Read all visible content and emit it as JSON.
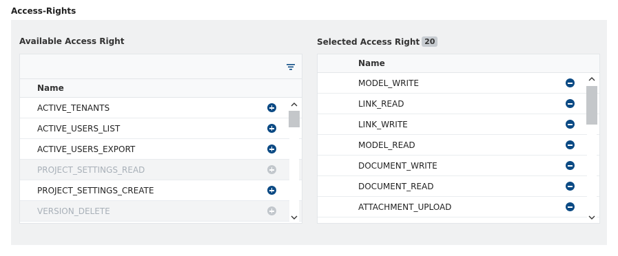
{
  "section": {
    "title": "Access-Rights"
  },
  "available": {
    "title": "Available Access Right",
    "column_header": "Name",
    "items": [
      {
        "label": "ACTIVE_TENANTS",
        "disabled": false
      },
      {
        "label": "ACTIVE_USERS_LIST",
        "disabled": false
      },
      {
        "label": "ACTIVE_USERS_EXPORT",
        "disabled": false
      },
      {
        "label": "PROJECT_SETTINGS_READ",
        "disabled": true
      },
      {
        "label": "PROJECT_SETTINGS_CREATE",
        "disabled": false
      },
      {
        "label": "VERSION_DELETE",
        "disabled": true
      }
    ]
  },
  "selected": {
    "title": "Selected Access Right",
    "count": "20",
    "column_header": "Name",
    "items": [
      {
        "label": "MODEL_WRITE"
      },
      {
        "label": "LINK_READ"
      },
      {
        "label": "LINK_WRITE"
      },
      {
        "label": "MODEL_READ"
      },
      {
        "label": "DOCUMENT_WRITE"
      },
      {
        "label": "DOCUMENT_READ"
      },
      {
        "label": "ATTACHMENT_UPLOAD"
      }
    ]
  },
  "colors": {
    "accent": "#0b4a84",
    "disabled": "#c2c7cc",
    "panel": "#f0f1f2"
  },
  "icons": {
    "filter": "filter-icon",
    "add": "plus-circle-icon",
    "remove": "minus-circle-icon"
  }
}
